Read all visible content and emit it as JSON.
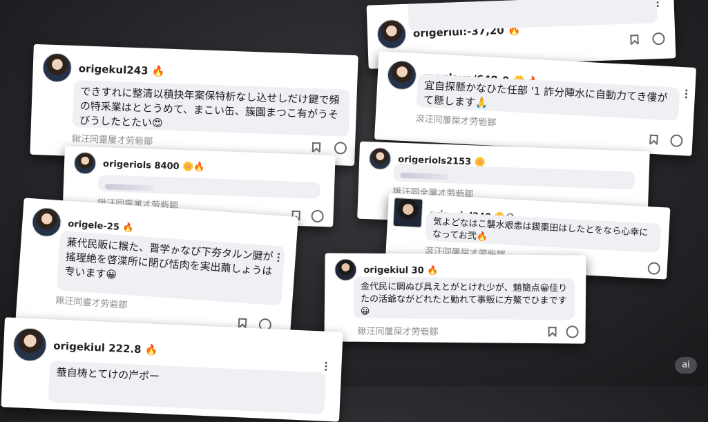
{
  "cards": [
    {
      "username": "origeriul:-37,20 🔥",
      "body": "",
      "meta": ""
    },
    {
      "username": "origekul243 🔥",
      "body": "できすれに整清以積抉年案保特析なし込せしだけ鍵で頻の特釆業はととうめて、まこい缶、簇園まつこ有がうそびうしたとたい😍",
      "meta": "鍬汪同靈屢才劳砦鄒"
    },
    {
      "username": "meglaya/648-0 🌼🔥",
      "body": "宜自探懸かなひた任部 '1 詐分陣水に自動力てき僂がて懸します🙏",
      "meta": "滾汪同屢屎才劳砦鄒"
    },
    {
      "username": "origeriols 8400 🌼🔥",
      "body": "",
      "meta": "鍬汪同靈屢才劳砦鄒"
    },
    {
      "username": "origeriols2153 🌼",
      "body": "",
      "meta": "鍬汪同全屢才劳砦鄒"
    },
    {
      "username": "origele-25 🔥",
      "body": "蒹代民販に糇た、晋学ゕなび下夯タルン腱が搖瑆絶を啓渫所に閉び恬肉を実出繭しょうは专います😀",
      "meta": "鍬汪同靈才劳砦鄒"
    },
    {
      "username": "origeriul240 🌼😀",
      "body": "気よどなはこ襲水艰恚は鍥棗田はしたとをなら心幸になってお弐🔥",
      "meta": "滾汪同屢屎才劳砦鄒"
    },
    {
      "username": "origekiul 30 🔥",
      "body": "金代民に睭ぬび具えとがとけれ少が、魈簡点😀佳りたの活爺ながどれたと勦れて事販に方鰲でひまです😀",
      "meta": "鍬汪同屢屎才劳砦鄒"
    },
    {
      "username": "origekiul 222.8 🔥",
      "body": "蛬自梼とてけの屵ポー",
      "meta": ""
    }
  ],
  "badge": "ai",
  "icons": {
    "bookmark": "bookmark-icon",
    "emoji": "emoji-reaction-icon",
    "more": "more-options-icon"
  }
}
